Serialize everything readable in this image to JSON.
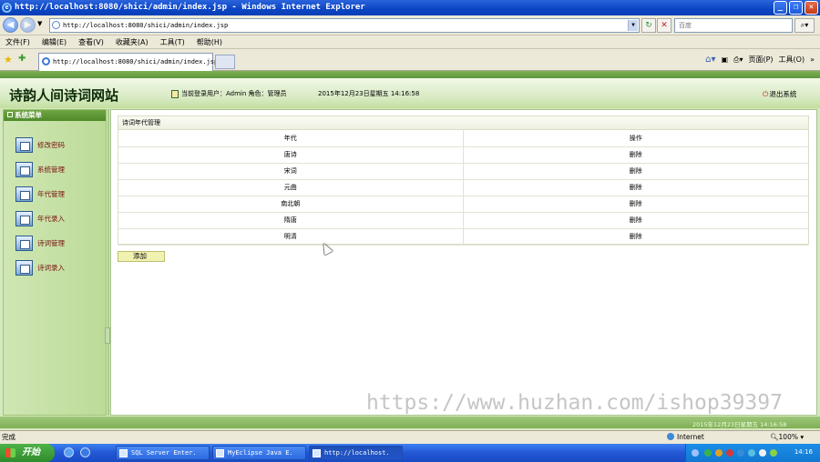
{
  "browser": {
    "title": "http://localhost:8080/shici/admin/index.jsp - Windows Internet Explorer",
    "address": "http://localhost:8080/shici/admin/index.jsp",
    "search_placeholder": "百度",
    "tab_title": "http://localhost:8080/shici/admin/index.jsp",
    "menu": [
      "文件(F)",
      "编辑(E)",
      "查看(V)",
      "收藏夹(A)",
      "工具(T)",
      "帮助(H)"
    ],
    "page_menu": "页面(P)",
    "tools_menu": "工具(O)",
    "status": "完成",
    "zone": "Internet",
    "zoom": "100%"
  },
  "app": {
    "site_title": "诗韵人间诗词网站",
    "user_info": "当前登录用户：Admin 角色：管理员",
    "datetime": "2015年12月23日星期五  14:16:58",
    "logout": "退出系统",
    "footer_datetime": "2015年12月23日星期五  14:16:58"
  },
  "sidebar": {
    "title": "系统菜单",
    "items": [
      {
        "label": "修改密码"
      },
      {
        "label": "系统管理"
      },
      {
        "label": "年代管理"
      },
      {
        "label": "年代录入"
      },
      {
        "label": "诗词管理"
      },
      {
        "label": "诗词录入"
      }
    ]
  },
  "panel": {
    "title": "诗词年代管理",
    "headers": [
      "年代",
      "操作"
    ],
    "rows": [
      {
        "era": "唐诗",
        "action": "删除"
      },
      {
        "era": "宋词",
        "action": "删除"
      },
      {
        "era": "元曲",
        "action": "删除"
      },
      {
        "era": "南北朝",
        "action": "删除"
      },
      {
        "era": "隋唐",
        "action": "删除"
      },
      {
        "era": "明清",
        "action": "删除"
      }
    ],
    "add_button": "添加"
  },
  "watermark": "https://www.huzhan.com/ishop39397",
  "taskbar": {
    "start": "开始",
    "buttons": [
      {
        "label": "SQL Server Enter."
      },
      {
        "label": "MyEclipse Java E."
      },
      {
        "label": "http://localhost."
      }
    ],
    "clock": "14:16"
  },
  "colors": {
    "accent_green": "#5e9638",
    "menu_text": "#7a1010",
    "xp_blue": "#2257d4"
  }
}
